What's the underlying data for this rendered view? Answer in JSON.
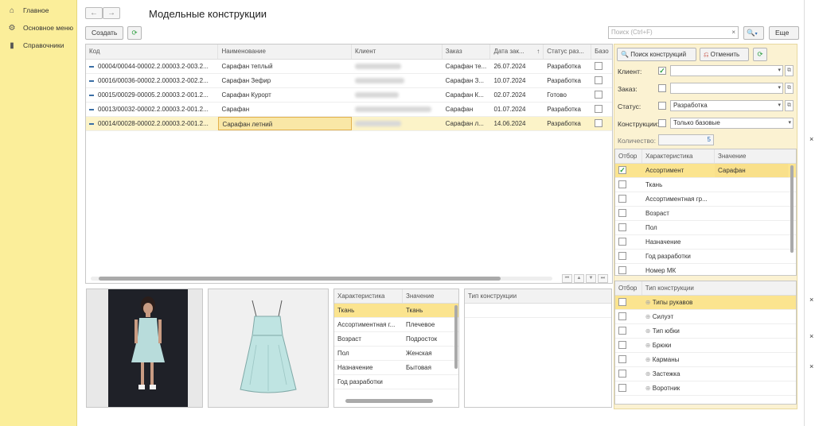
{
  "sidebar": {
    "items": [
      {
        "label": "Главное",
        "icon": "home-icon"
      },
      {
        "label": "Основное меню",
        "icon": "gear-icon"
      },
      {
        "label": "Справочники",
        "icon": "books-icon"
      }
    ]
  },
  "header": {
    "title": "Модельные конструкции",
    "back": "←",
    "forward": "→"
  },
  "toolbar": {
    "create_label": "Создать",
    "search_placeholder": "Поиск (Ctrl+F)",
    "search_clear": "×",
    "more_label": "Еще"
  },
  "table": {
    "columns": [
      "Код",
      "Наименование",
      "Клиент",
      "Заказ",
      "Дата зак...",
      "Статус раз...",
      "Базо"
    ],
    "sort_indicator": "↑",
    "rows": [
      {
        "code": "00004/00044-00002.2.00003.2-003.2...",
        "name": "Сарафан теплый",
        "order": "Сарафан те...",
        "date": "26.07.2024",
        "status": "Разработка"
      },
      {
        "code": "00016/00036-00002.2.00003.2-002.2...",
        "name": "Сарафан Зефир",
        "order": "Сарафан З...",
        "date": "10.07.2024",
        "status": "Разработка"
      },
      {
        "code": "00015/00029-00005.2.00003.2-001.2...",
        "name": "Сарафан Курорт",
        "order": "Сарафан К...",
        "date": "02.07.2024",
        "status": "Готово"
      },
      {
        "code": "00013/00032-00002.2.00003.2-001.2...",
        "name": "Сарафан",
        "order": "Сарафан",
        "date": "01.07.2024",
        "status": "Разработка"
      },
      {
        "code": "00014/00028-00002.2.00003.2-001.2...",
        "name": "Сарафан летний",
        "order": "Сарафан л...",
        "date": "14.06.2024",
        "status": "Разработка"
      }
    ]
  },
  "details": {
    "columns": [
      "Характеристика",
      "Значение"
    ],
    "rows": [
      {
        "k": "Ткань",
        "v": "Ткань"
      },
      {
        "k": "Ассортиментная г...",
        "v": "Плечевое"
      },
      {
        "k": "Возраст",
        "v": "Подросток"
      },
      {
        "k": "Пол",
        "v": "Женская"
      },
      {
        "k": "Назначение",
        "v": "Бытовая"
      },
      {
        "k": "Год разработки",
        "v": ""
      }
    ],
    "type_header": "Тип конструкции"
  },
  "filter_panel": {
    "search_btn": "Поиск конструкций",
    "cancel_btn": "Отменить",
    "client_label": "Клиент:",
    "order_label": "Заказ:",
    "status_label": "Статус:",
    "status_value": "Разработка",
    "constructions_label": "Конструкции:",
    "constructions_value": "Только базовые",
    "count_label": "Количество:",
    "count_value": "5",
    "char_columns": [
      "Отбор",
      "Характеристика",
      "Значение"
    ],
    "chars": [
      {
        "name": "Ассортимент",
        "value": "Сарафан",
        "checked": true
      },
      {
        "name": "Ткань",
        "value": "",
        "checked": false
      },
      {
        "name": "Ассортиментная гр...",
        "value": "",
        "checked": false
      },
      {
        "name": "Возраст",
        "value": "",
        "checked": false
      },
      {
        "name": "Пол",
        "value": "",
        "checked": false
      },
      {
        "name": "Назначение",
        "value": "",
        "checked": false
      },
      {
        "name": "Год разработки",
        "value": "",
        "checked": false
      },
      {
        "name": "Номер МК",
        "value": "",
        "checked": false
      }
    ],
    "type_columns": [
      "Отбор",
      "Тип конструкции"
    ],
    "types": [
      "Типы рукавов",
      "Силуэт",
      "Тип юбки",
      "Брюки",
      "Карманы",
      "Застежка",
      "Воротник"
    ]
  },
  "colors": {
    "sidebar": "#fbee9a",
    "accent": "#2a9d3c",
    "selection": "#fcf3c8"
  }
}
